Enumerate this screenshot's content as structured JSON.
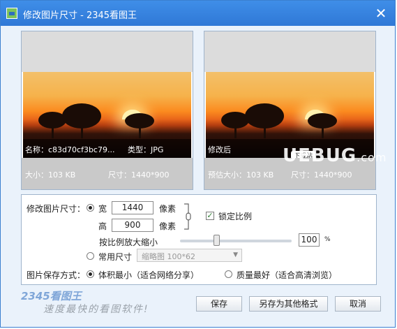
{
  "window": {
    "title": "修改图片尺寸 - 2345看图王",
    "close_glyph": "✕"
  },
  "preview_left": {
    "name_line": "名称：c83d70cf3bc79...",
    "type_line": "类型：JPG",
    "size_line": "大小：103 KB",
    "dims_line": "尺寸：1440*900"
  },
  "preview_right": {
    "name_line": "修改后",
    "download_badge": "下载站",
    "size_line": "预估大小：103 KB",
    "dims_line": "尺寸：1440*900"
  },
  "watermark": {
    "main": "UEBUG",
    "domain": ".com"
  },
  "settings": {
    "resize_label": "修改图片尺寸：",
    "width_label": "宽",
    "width_value": "1440",
    "width_unit": "像素",
    "height_label": "高",
    "height_value": "900",
    "height_unit": "像素",
    "lock_ratio_label": "锁定比例",
    "lock_ratio_checked": true,
    "scale_label": "按比例放大缩小",
    "scale_value": "100",
    "scale_unit": "%",
    "scale_fraction": 0.33,
    "common_size_label": "常用尺寸",
    "common_size_value": "缩略图 100*62",
    "save_method_label": "图片保存方式：",
    "option_small": "体积最小（适合网络分享）",
    "option_quality": "质量最好（适合高清浏览）"
  },
  "buttons": {
    "save": "保存",
    "save_as": "另存为其他格式",
    "cancel": "取消"
  },
  "footer": {
    "brand": "2345看图王",
    "slogan": "速度最快的看图软件!"
  },
  "colors": {
    "titlebar": "#2f78d6",
    "border": "#9fb4cc",
    "brand": "#7fa6d8"
  },
  "icons": [
    "app-icon",
    "close-icon",
    "link-bracket-icon",
    "checkmark-icon",
    "dropdown-arrow-icon"
  ]
}
